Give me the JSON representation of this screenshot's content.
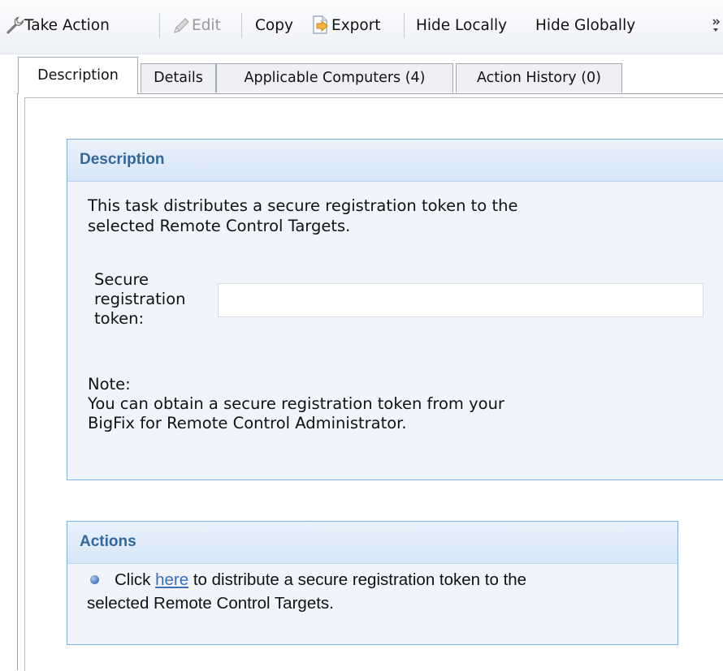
{
  "toolbar": {
    "take_action": "Take Action",
    "edit": "Edit",
    "copy": "Copy",
    "export": "Export",
    "hide_locally": "Hide Locally",
    "hide_globally": "Hide Globally"
  },
  "tabs": {
    "description": "Description",
    "details": "Details",
    "applicable_computers": "Applicable Computers (4)",
    "action_history": "Action History (0)",
    "active": "Description"
  },
  "description_section": {
    "title": "Description",
    "line1": "This task distributes a secure registration token to the",
    "line2": "selected Remote Control Targets.",
    "token_label_1": "Secure",
    "token_label_2": "registration",
    "token_label_3": "token:",
    "token_value": "",
    "note_label": "Note:",
    "note_line1": "You can obtain a secure registration token from your",
    "note_line2": "BigFix for Remote Control Administrator."
  },
  "actions_section": {
    "title": "Actions",
    "click_prefix": "Click ",
    "link_text": "here",
    "click_suffix": " to distribute a secure registration token to the",
    "line2": "selected Remote Control Targets."
  },
  "colors": {
    "section_border": "#7fb1e2",
    "section_title": "#33669a",
    "link": "#3b6fb6",
    "section_bg": "#f1f5fb"
  },
  "icons": {
    "take_action": "wrench-icon",
    "edit": "pencil-icon",
    "export": "export-icon",
    "overflow": "toolbar-overflow-icon",
    "bullet": "bullet-icon"
  }
}
